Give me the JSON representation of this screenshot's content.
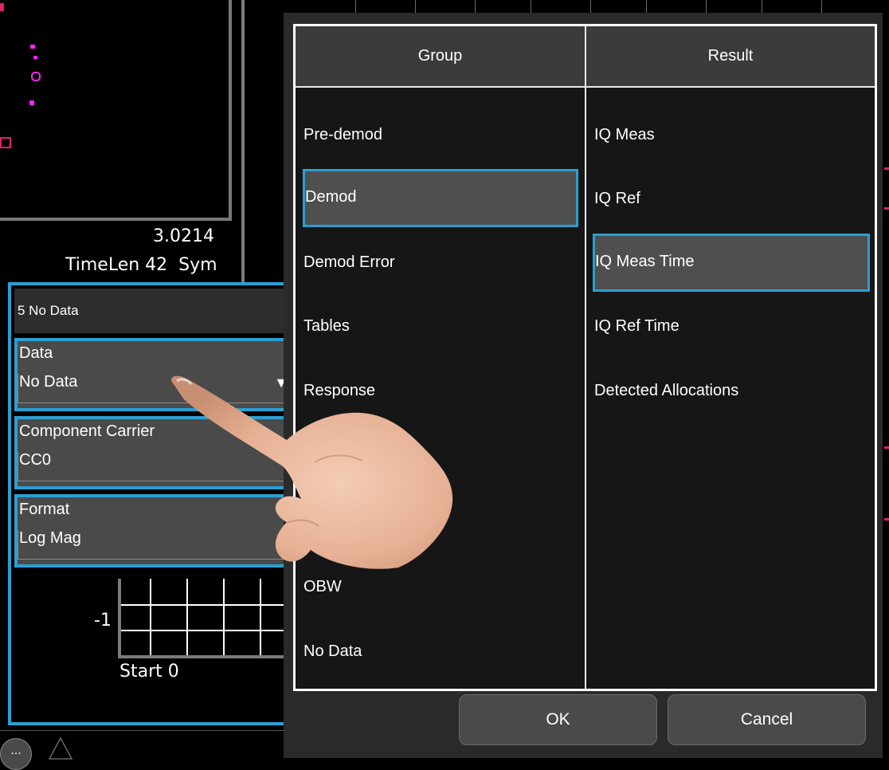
{
  "background": {
    "trace_value": "3.0214",
    "time_len_label": "TimeLen 42  Sym",
    "axis_value": "-1",
    "start_label": "Start 0",
    "more_button": "..."
  },
  "trace_panel": {
    "header": "5 No Data",
    "fields": [
      {
        "label": "Data",
        "value": "No Data",
        "has_dropdown": true
      },
      {
        "label": "Component Carrier",
        "value": "CC0",
        "has_dropdown": false
      },
      {
        "label": "Format",
        "value": "Log Mag",
        "has_dropdown": true
      }
    ],
    "dropdown_glyph": "▼"
  },
  "dialog": {
    "group_header": "Group",
    "result_header": "Result",
    "groups": [
      {
        "label": "Pre-demod",
        "selected": false
      },
      {
        "label": "Demod",
        "selected": true
      },
      {
        "label": "Demod Error",
        "selected": false
      },
      {
        "label": "Tables",
        "selected": false
      },
      {
        "label": "Response",
        "selected": false
      },
      {
        "label": "OBW",
        "selected": false
      },
      {
        "label": "No Data",
        "selected": false
      }
    ],
    "results": [
      {
        "label": "IQ Meas",
        "selected": false
      },
      {
        "label": "IQ Ref",
        "selected": false
      },
      {
        "label": "IQ Meas Time",
        "selected": true
      },
      {
        "label": "IQ Ref Time",
        "selected": false
      },
      {
        "label": "Detected Allocations",
        "selected": false
      }
    ],
    "ok_label": "OK",
    "cancel_label": "Cancel"
  },
  "colors": {
    "accent": "#2b9fd2",
    "trace_marker": "#ff22ff",
    "panel": "#4a4a4a"
  }
}
